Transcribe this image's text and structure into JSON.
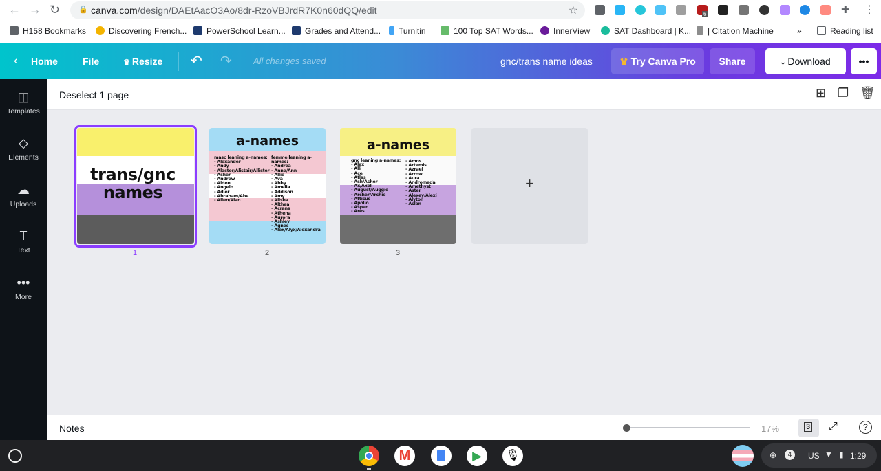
{
  "browser": {
    "url_domain": "canva.com",
    "url_path": "/design/DAEtAacO3Ao/8dr-RzoVBJrdR7K0n60dQQ/edit",
    "ext_badge": "6",
    "bookmarks": [
      "H158 Bookmarks",
      "Discovering French...",
      "PowerSchool Learn...",
      "Grades and Attend...",
      "Turnitin",
      "100 Top SAT Words...",
      "InnerView",
      "SAT Dashboard | K...",
      "| Citation Machine"
    ],
    "more": "»",
    "reading_list": "Reading list"
  },
  "header": {
    "home": "Home",
    "file": "File",
    "resize": "Resize",
    "status": "All changes saved",
    "title": "gnc/trans name ideas",
    "try_pro": "Try Canva Pro",
    "share": "Share",
    "download": "Download",
    "more": "•••"
  },
  "sidebar": [
    {
      "label": "Templates",
      "icon": "templates-icon"
    },
    {
      "label": "Elements",
      "icon": "elements-icon"
    },
    {
      "label": "Uploads",
      "icon": "uploads-icon"
    },
    {
      "label": "Text",
      "icon": "text-icon"
    },
    {
      "label": "More",
      "icon": "more-icon"
    }
  ],
  "pagebar": {
    "deselect": "Deselect 1 page"
  },
  "pages": [
    {
      "number": "1",
      "title": "trans/gnc names",
      "colors": [
        "#f9f06c",
        "#ffffff",
        "#b590db",
        "#5c5c5c"
      ]
    },
    {
      "number": "2",
      "title": "a-names",
      "colors": [
        "#a4dcf5",
        "#f4c8d2",
        "#ffffff",
        "#f4c8d2",
        "#a4dcf5"
      ],
      "col1": "masc leaning a-names:\n- Alexander\n- Andy\n- Alastor/Alistair/Allister\n- Asher\n- Andrew\n- Aiden\n- Angelo\n- Adler\n- Abraham/Abe\n- Allen/Alan",
      "col2": "femme leaning a-\nnames:\n- Andrea\n- Anne/Ann\n- Allie\n- Ava\n- Abby\n- Amelia\n- Addison\n- Amy\n- Alisha\n- Althea\n- Acrana\n- Athena\n- Aurora\n- Ashley\n- Agnes\n- Alex/Alyx/Alexandra"
    },
    {
      "number": "3",
      "title": "a-names",
      "colors": [
        "#f7f085",
        "#fafafa",
        "#c7a4e0",
        "#6e6e6e"
      ],
      "col1": "gnc leaning a-names:\n- Alex\n- Alli\n- Ace\n- Atlas\n- Ash/Asher\n- Ax/Axel\n- August/Auggie\n- Archer/Archie\n- Atticus\n- Apollo\n- Aspen\n- Ares",
      "col2": "- Amos\n- Artemis\n- Azrael\n- Arrow\n- Aura\n- Andromeda\n- Amethyst\n- Aster\n- Alexey/Alexi\n- Alyton\n- Aslan"
    }
  ],
  "add_page": "+",
  "notes": {
    "label": "Notes",
    "zoom": "17%",
    "zoom_fraction": 0.0,
    "page_count": "3",
    "help": "?"
  },
  "taskbar": {
    "locale": "US",
    "time": "1:29",
    "notif": "4"
  },
  "colors": {
    "accent": "#8b3dff"
  }
}
